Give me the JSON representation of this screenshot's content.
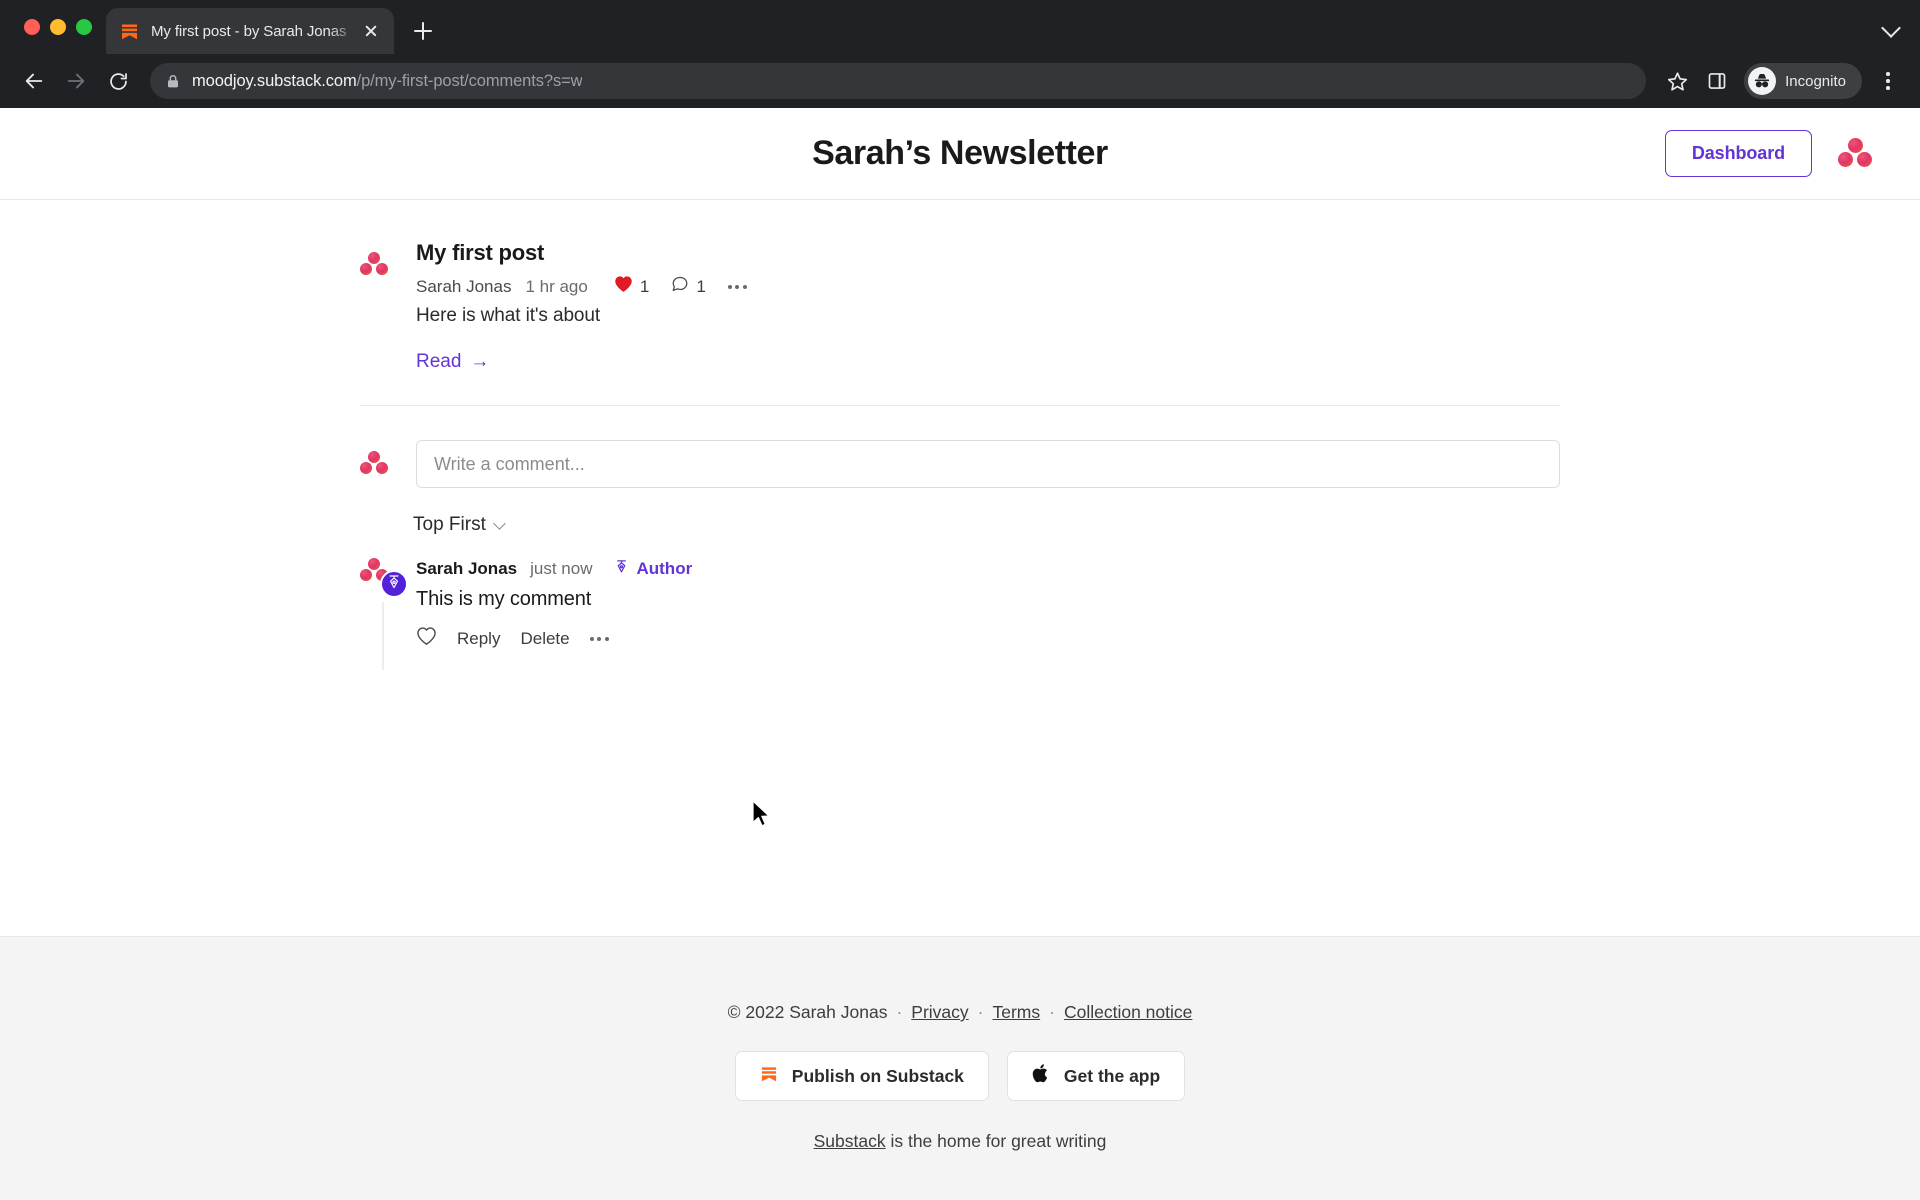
{
  "browser": {
    "tab": {
      "title": "My first post - by Sarah Jonas",
      "favicon": "substack-icon",
      "close": "close-icon"
    },
    "new_tab_label": "+",
    "tabstrip_chevron": "chevron-down-icon",
    "back": "back-arrow-icon",
    "forward": "forward-arrow-icon",
    "reload": "reload-icon",
    "address": {
      "lock": "lock-icon",
      "domain": "moodjoy.substack.com",
      "path": "/p/my-first-post/comments?s=w"
    },
    "bookmark": "star-icon",
    "side_panel": "side-panel-icon",
    "profile": {
      "label": "Incognito",
      "icon": "incognito-icon"
    },
    "menu": "kebab-menu-icon"
  },
  "header": {
    "title": "Sarah’s Newsletter",
    "dashboard_label": "Dashboard",
    "avatar": "substack-logo-avatar"
  },
  "post": {
    "avatar": "post-avatar",
    "title": "My first post",
    "author": "Sarah Jonas",
    "time": "1 hr ago",
    "like_icon": "heart-filled-icon",
    "like_count": "1",
    "comment_icon": "comment-bubble-icon",
    "comment_count": "1",
    "more_icon": "ellipsis-icon",
    "subtitle": "Here is what it's about",
    "read_label": "Read",
    "read_arrow": "→"
  },
  "composer": {
    "avatar": "composer-avatar",
    "placeholder": "Write a comment...",
    "value": ""
  },
  "sort": {
    "label": "Top First",
    "chevron": "chevron-down-icon"
  },
  "comment": {
    "avatar": "comment-avatar",
    "author_badge_icon": "pen-nib-icon",
    "name": "Sarah Jonas",
    "time": "just now",
    "author_tag_icon": "pen-nib-icon",
    "author_tag": "Author",
    "text": "This is my comment",
    "like_icon": "heart-outline-icon",
    "reply_label": "Reply",
    "delete_label": "Delete",
    "more_icon": "ellipsis-icon"
  },
  "footer": {
    "copyright": "© 2022 Sarah Jonas",
    "links": [
      "Privacy",
      "Terms",
      "Collection notice"
    ],
    "publish_label": "Publish on Substack",
    "publish_icon": "substack-icon",
    "app_label": "Get the app",
    "app_icon": "apple-icon",
    "tagline_link": "Substack",
    "tagline_rest": " is the home for great writing"
  },
  "colors": {
    "accent_purple": "#6334d6",
    "badge_purple": "#5321d8",
    "logo_pink": "#e0356b",
    "logo_orange": "#e8642c",
    "substack_orange": "#ff6719",
    "like_red": "#e01b24",
    "footer_bg": "#f4f4f4"
  }
}
